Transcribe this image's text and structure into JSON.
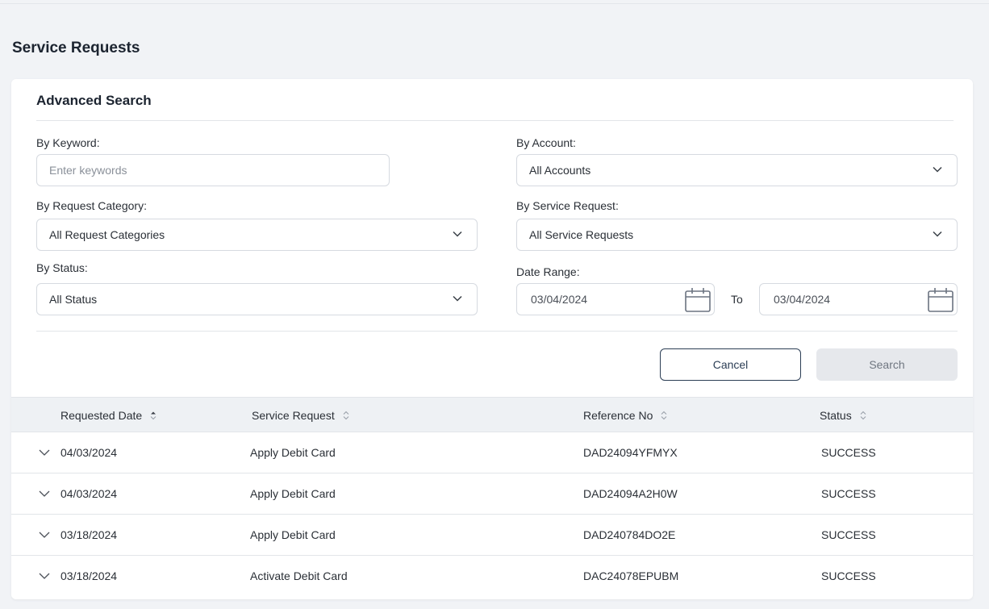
{
  "page": {
    "title": "Service Requests"
  },
  "search": {
    "title": "Advanced Search",
    "keyword": {
      "label": "By Keyword:",
      "placeholder": "Enter keywords",
      "value": ""
    },
    "account": {
      "label": "By Account:",
      "value": "All Accounts"
    },
    "category": {
      "label": "By Request Category:",
      "value": "All Request Categories"
    },
    "service_request": {
      "label": "By Service Request:",
      "value": "All Service Requests"
    },
    "status": {
      "label": "By Status:",
      "value": "All Status"
    },
    "date_range": {
      "label": "Date Range:",
      "from": "03/04/2024",
      "to_label": "To",
      "to": "03/04/2024"
    },
    "cancel_label": "Cancel",
    "search_label": "Search"
  },
  "table": {
    "headers": [
      "Requested Date",
      "Service Request",
      "Reference No",
      "Status"
    ],
    "rows": [
      {
        "date": "04/03/2024",
        "request": "Apply Debit Card",
        "ref": "DAD24094YFMYX",
        "status": "SUCCESS"
      },
      {
        "date": "04/03/2024",
        "request": "Apply Debit Card",
        "ref": "DAD24094A2H0W",
        "status": "SUCCESS"
      },
      {
        "date": "03/18/2024",
        "request": "Apply Debit Card",
        "ref": "DAD240784DO2E",
        "status": "SUCCESS"
      },
      {
        "date": "03/18/2024",
        "request": "Activate Debit Card",
        "ref": "DAC24078EPUBM",
        "status": "SUCCESS"
      }
    ]
  }
}
